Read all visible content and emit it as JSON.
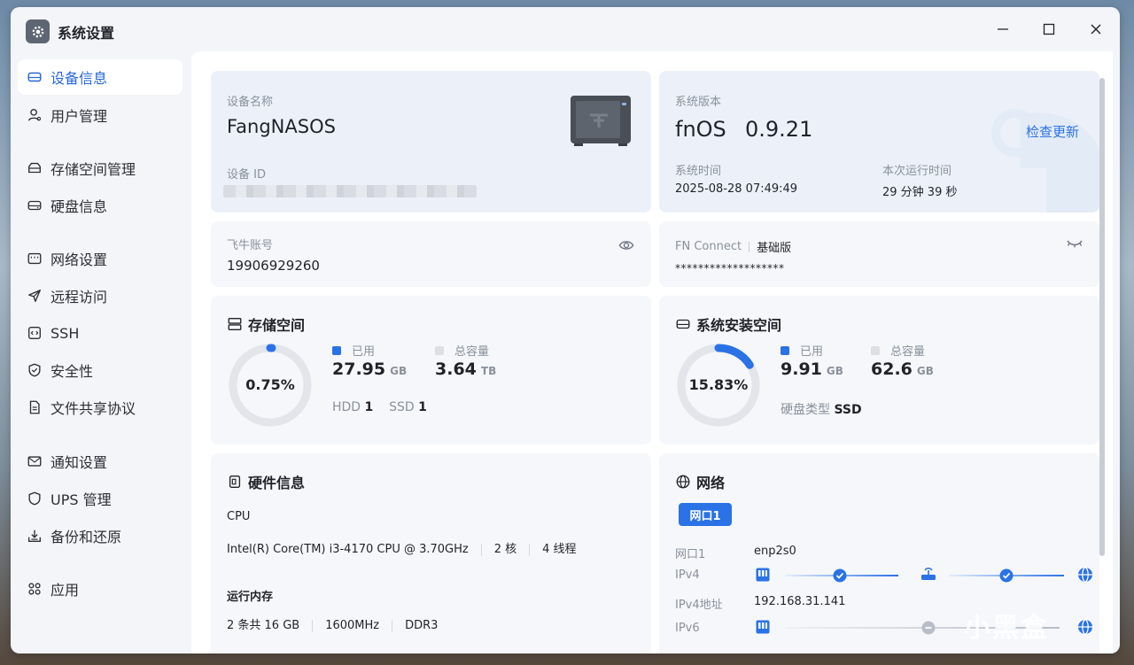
{
  "window": {
    "title": "系统设置"
  },
  "sidebar": {
    "items": [
      {
        "label": "设备信息",
        "icon": "device-icon"
      },
      {
        "label": "用户管理",
        "icon": "user-icon"
      },
      {
        "label": "存储空间管理",
        "icon": "storage-icon"
      },
      {
        "label": "硬盘信息",
        "icon": "disk-icon"
      },
      {
        "label": "网络设置",
        "icon": "network-icon"
      },
      {
        "label": "远程访问",
        "icon": "send-icon"
      },
      {
        "label": "SSH",
        "icon": "terminal-icon"
      },
      {
        "label": "安全性",
        "icon": "shield-check-icon"
      },
      {
        "label": "文件共享协议",
        "icon": "file-icon"
      },
      {
        "label": "通知设置",
        "icon": "mail-icon"
      },
      {
        "label": "UPS 管理",
        "icon": "ups-shield-icon"
      },
      {
        "label": "备份和还原",
        "icon": "backup-icon"
      },
      {
        "label": "应用",
        "icon": "apps-icon"
      }
    ]
  },
  "device": {
    "name_label": "设备名称",
    "name": "FangNASOS",
    "id_label": "设备 ID"
  },
  "system": {
    "version_label": "系统版本",
    "os_name": "fnOS",
    "version": "0.9.21",
    "check_update": "检查更新",
    "time_label": "系统时间",
    "time": "2025-08-28 07:49:49",
    "uptime_label": "本次运行时间",
    "uptime": "29 分钟 39 秒"
  },
  "account": {
    "label": "飞牛账号",
    "value": "19906929260"
  },
  "connect": {
    "label": "FN Connect",
    "plan": "基础版",
    "masked": "*******************"
  },
  "storage": {
    "title": "存储空间",
    "percent_text": "0.75%",
    "percent": 0.0075,
    "used_label": "已用",
    "used": "27.95",
    "used_unit": "GB",
    "total_label": "总容量",
    "total": "3.64",
    "total_unit": "TB",
    "hdd_label": "HDD",
    "hdd": "1",
    "ssd_label": "SSD",
    "ssd": "1"
  },
  "sysdisk": {
    "title": "系统安装空间",
    "percent_text": "15.83%",
    "percent": 0.1583,
    "used_label": "已用",
    "used": "9.91",
    "used_unit": "GB",
    "total_label": "总容量",
    "total": "62.6",
    "total_unit": "GB",
    "type_label": "硬盘类型",
    "type": "SSD"
  },
  "hardware": {
    "title": "硬件信息",
    "cpu_label": "CPU",
    "cpu_model": "Intel(R) Core(TM) i3-4170 CPU @ 3.70GHz",
    "cores": "2 核",
    "threads": "4 线程",
    "mem_label": "运行内存",
    "mem_size": "2 条共 16 GB",
    "mem_freq": "1600MHz",
    "mem_type": "DDR3"
  },
  "network": {
    "title": "网络",
    "tab": "网口1",
    "port_label": "网口1",
    "port_value": "enp2s0",
    "ipv4_label": "IPv4",
    "ipv4_addr_label": "IPv4地址",
    "ipv4_addr": "192.168.31.141",
    "ipv6_label": "IPv6"
  },
  "colors": {
    "accent": "#2a72e5",
    "ring_bg": "#e2e5ea",
    "card": "#f5f7fa",
    "card_blue": "#ecf1f9"
  },
  "watermark": "小黑盒"
}
